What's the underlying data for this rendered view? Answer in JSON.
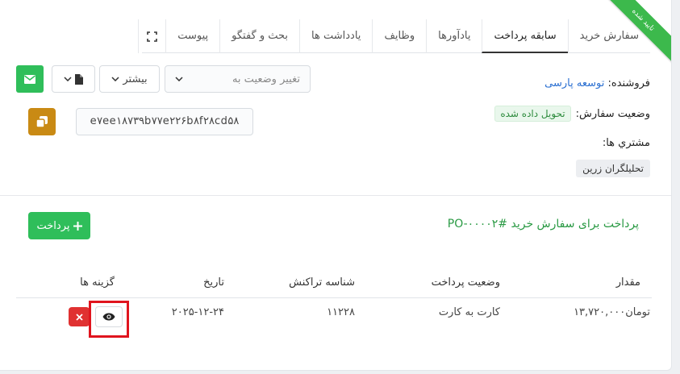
{
  "ribbon": {
    "text": "تایید شده"
  },
  "tabs": [
    {
      "label": "سفارش خرید"
    },
    {
      "label": "سابقه پرداخت"
    },
    {
      "label": "یادآورها"
    },
    {
      "label": "وظایف"
    },
    {
      "label": "یادداشت ها"
    },
    {
      "label": "بحث و گفتگو"
    },
    {
      "label": "پیوست"
    }
  ],
  "info": {
    "vendor_label": "فروشنده:",
    "vendor_name": "توسعه پارسی",
    "status_label": "وضعیت سفارش:",
    "status_value": "تحویل داده شده",
    "customers_label": "مشتري ها:",
    "customer_tag": "تحلیلگران زرین"
  },
  "controls": {
    "status_placeholder": "تغییر وضعیت به",
    "more_label": "بیشتر",
    "hash": "e۷ee۱۸۷۳۹b۷۷e۲۲۶b۸f۲۸cd۵۸"
  },
  "payment": {
    "title": "پرداخت برای سفارش خرید #PO-۰۰۰۰۲",
    "add_button": "پرداخت",
    "columns": {
      "amount": "مقدار",
      "payment_status": "وضعیت پرداخت",
      "transaction_id": "شناسه تراکنش",
      "date": "تاریخ",
      "options": "گزینه ها"
    },
    "rows": [
      {
        "amount": "تومان۱۳,۷۲۰,۰۰۰",
        "payment_status": "کارت به کارت",
        "transaction_id": "۱۱۲۲۸",
        "date": "۲۰۲۵-۱۲-۲۴"
      }
    ]
  }
}
